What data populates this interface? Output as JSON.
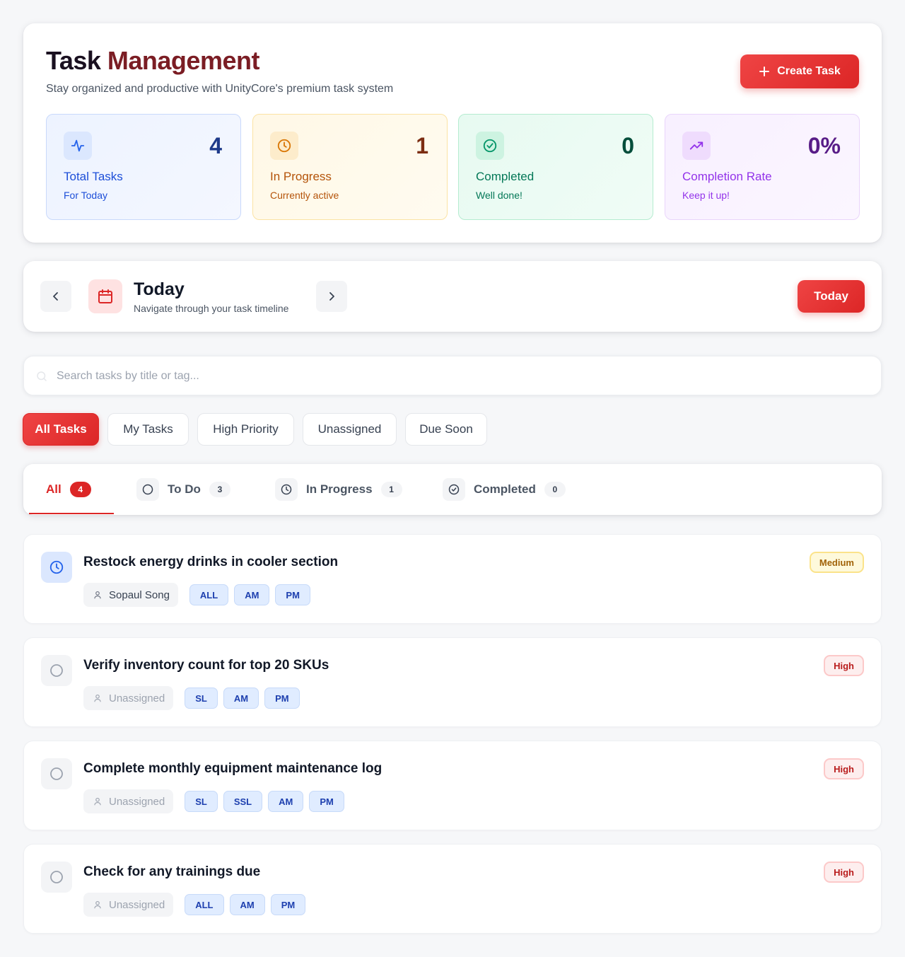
{
  "header": {
    "title_part1": "Task",
    "title_part2": "Management",
    "subtitle": "Stay organized and productive with UnityCore's premium task system",
    "create_button": "Create Task"
  },
  "stats": [
    {
      "value": "4",
      "label": "Total Tasks",
      "sub": "For Today",
      "icon": "activity-icon"
    },
    {
      "value": "1",
      "label": "In Progress",
      "sub": "Currently active",
      "icon": "clock-icon"
    },
    {
      "value": "0",
      "label": "Completed",
      "sub": "Well done!",
      "icon": "check-circle-icon"
    },
    {
      "value": "0%",
      "label": "Completion Rate",
      "sub": "Keep it up!",
      "icon": "trending-up-icon"
    }
  ],
  "nav": {
    "title": "Today",
    "subtitle": "Navigate through your task timeline",
    "today_button": "Today"
  },
  "search": {
    "placeholder": "Search tasks by title or tag..."
  },
  "filters": [
    "All Tasks",
    "My Tasks",
    "High Priority",
    "Unassigned",
    "Due Soon"
  ],
  "tabs": [
    {
      "label": "All",
      "count": "4"
    },
    {
      "label": "To Do",
      "count": "3"
    },
    {
      "label": "In Progress",
      "count": "1"
    },
    {
      "label": "Completed",
      "count": "0"
    }
  ],
  "tasks": [
    {
      "title": "Restock energy drinks in cooler section",
      "assignee": "Sopaul Song",
      "tags": [
        "ALL",
        "AM",
        "PM"
      ],
      "priority": "Medium",
      "status": "in-progress"
    },
    {
      "title": "Verify inventory count for top 20 SKUs",
      "assignee": "Unassigned",
      "tags": [
        "SL",
        "AM",
        "PM"
      ],
      "priority": "High",
      "status": "todo"
    },
    {
      "title": "Complete monthly equipment maintenance log",
      "assignee": "Unassigned",
      "tags": [
        "SL",
        "SSL",
        "AM",
        "PM"
      ],
      "priority": "High",
      "status": "todo"
    },
    {
      "title": "Check for any trainings due",
      "assignee": "Unassigned",
      "tags": [
        "ALL",
        "AM",
        "PM"
      ],
      "priority": "High",
      "status": "todo"
    }
  ],
  "colors": {
    "accent": "#dc2626",
    "tag_bg": "#e0ecff",
    "tag_text": "#1e40af"
  }
}
